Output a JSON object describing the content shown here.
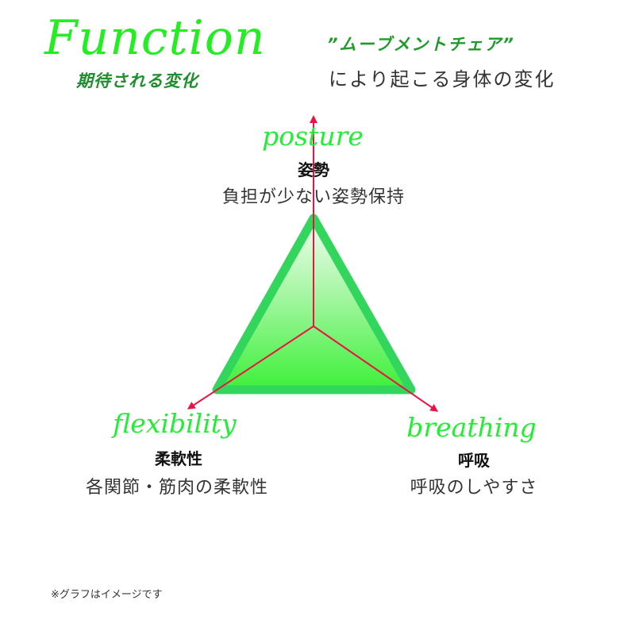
{
  "header": {
    "title_en": "Function",
    "title_jp": "期待される変化",
    "subtitle_product": "”ムーブメントチェア”",
    "subtitle_text": "により起こる身体の変化"
  },
  "axes": [
    {
      "id": "posture",
      "label_en": "posture",
      "label_jp": "姿勢",
      "description": "負担が少ない姿勢保持"
    },
    {
      "id": "flexibility",
      "label_en": "flexibility",
      "label_jp": "柔軟性",
      "description": "各関節・筋肉の柔軟性"
    },
    {
      "id": "breathing",
      "label_en": "breathing",
      "label_jp": "呼吸",
      "description": "呼吸のしやすさ"
    }
  ],
  "colors": {
    "triangle_stroke": "#33d65c",
    "triangle_fill_top": "#f0fff0",
    "triangle_fill_bottom": "#3ef03a",
    "axis_arrow": "#ee1144",
    "accent_green": "#22ee22",
    "dark_green": "#1f8f2f"
  },
  "footnote": "※グラフはイメージです"
}
